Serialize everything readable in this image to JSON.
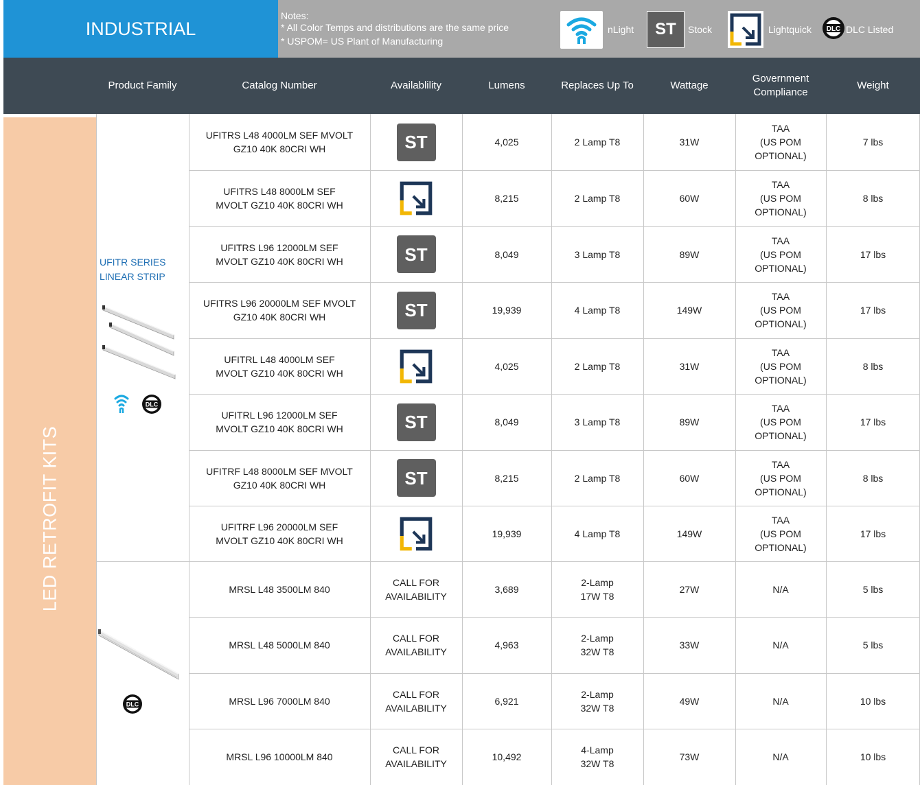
{
  "header": {
    "section": "INDUSTRIAL",
    "notes": {
      "title": "Notes:",
      "line1": "* All Color Temps and distributions are the same price",
      "line2": "* USPOM= US Plant of Manufacturing"
    },
    "legend": {
      "nlight": {
        "label": "nLight",
        "icon": "nlight-wifi-icon"
      },
      "stock": {
        "label": "Stock",
        "badge": "ST",
        "icon": "stock-st-icon"
      },
      "lightquick": {
        "label": "Lightquick",
        "icon": "lightquick-icon"
      },
      "dlc": {
        "label": "DLC Listed",
        "icon": "dlc-listed-icon",
        "badge": "DLC"
      }
    }
  },
  "columns": {
    "family": "Product Family",
    "catalog": "Catalog Number",
    "availability": "Availablility",
    "lumens": "Lumens",
    "replaces": "Replaces Up To",
    "wattage": "Wattage",
    "compliance_line1": "Government",
    "compliance_line2": "Compliance",
    "weight": "Weight"
  },
  "sidebar": {
    "label": "LED RETROFIT KITS"
  },
  "families": {
    "ufitr": {
      "line1": "UFITR SERIES",
      "line2": "LINEAR STRIP"
    }
  },
  "rows": [
    {
      "catalog": [
        "UFITRS L48 4000LM SEF MVOLT",
        "GZ10 40K 80CRI WH"
      ],
      "availability": "stock",
      "lumens": "4,025",
      "replaces": [
        "2 Lamp T8"
      ],
      "wattage": "31W",
      "compliance": [
        "TAA",
        "(US POM",
        "OPTIONAL)"
      ],
      "weight": "7 lbs"
    },
    {
      "catalog": [
        "UFITRS L48 8000LM SEF",
        "MVOLT GZ10 40K 80CRI WH"
      ],
      "availability": "lightquick",
      "lumens": "8,215",
      "replaces": [
        "2 Lamp T8"
      ],
      "wattage": "60W",
      "compliance": [
        "TAA",
        "(US POM",
        "OPTIONAL)"
      ],
      "weight": "8 lbs"
    },
    {
      "catalog": [
        "UFITRS L96 12000LM SEF",
        "MVOLT GZ10 40K 80CRI WH"
      ],
      "availability": "stock",
      "lumens": "8,049",
      "replaces": [
        "3 Lamp T8"
      ],
      "wattage": "89W",
      "compliance": [
        "TAA",
        "(US POM",
        "OPTIONAL)"
      ],
      "weight": "17 lbs"
    },
    {
      "catalog": [
        "UFITRS L96 20000LM SEF MVOLT",
        "GZ10 40K 80CRI WH"
      ],
      "availability": "stock",
      "lumens": "19,939",
      "replaces": [
        "4 Lamp T8"
      ],
      "wattage": "149W",
      "compliance": [
        "TAA",
        "(US POM",
        "OPTIONAL)"
      ],
      "weight": "17 lbs"
    },
    {
      "catalog": [
        "UFITRL L48 4000LM SEF",
        "MVOLT GZ10 40K 80CRI WH"
      ],
      "availability": "lightquick",
      "lumens": "4,025",
      "replaces": [
        "2 Lamp T8"
      ],
      "wattage": "31W",
      "compliance": [
        "TAA",
        "(US POM",
        "OPTIONAL)"
      ],
      "weight": "8 lbs"
    },
    {
      "catalog": [
        "UFITRL L96 12000LM SEF",
        "MVOLT GZ10 40K 80CRI WH"
      ],
      "availability": "stock",
      "lumens": "8,049",
      "replaces": [
        "3 Lamp T8"
      ],
      "wattage": "89W",
      "compliance": [
        "TAA",
        "(US POM",
        "OPTIONAL)"
      ],
      "weight": "17 lbs"
    },
    {
      "catalog": [
        "UFITRF L48 8000LM SEF MVOLT",
        "GZ10 40K 80CRI WH"
      ],
      "availability": "stock",
      "lumens": "8,215",
      "replaces": [
        "2 Lamp T8"
      ],
      "wattage": "60W",
      "compliance": [
        "TAA",
        "(US POM",
        "OPTIONAL)"
      ],
      "weight": "8 lbs"
    },
    {
      "catalog": [
        "UFITRF L96 20000LM SEF",
        "MVOLT GZ10 40K 80CRI WH"
      ],
      "availability": "lightquick",
      "lumens": "19,939",
      "replaces": [
        "4 Lamp T8"
      ],
      "wattage": "149W",
      "compliance": [
        "TAA",
        "(US POM",
        "OPTIONAL)"
      ],
      "weight": "17 lbs"
    },
    {
      "catalog": [
        "MRSL L48 3500LM 840"
      ],
      "availability": [
        "CALL FOR",
        "AVAILABILITY"
      ],
      "lumens": "3,689",
      "replaces": [
        "2-Lamp",
        "17W T8"
      ],
      "wattage": "27W",
      "compliance": [
        "N/A"
      ],
      "weight": "5 lbs"
    },
    {
      "catalog": [
        "MRSL L48 5000LM 840"
      ],
      "availability": [
        "CALL FOR",
        "AVAILABILITY"
      ],
      "lumens": "4,963",
      "replaces": [
        "2-Lamp",
        "32W T8"
      ],
      "wattage": "33W",
      "compliance": [
        "N/A"
      ],
      "weight": "5 lbs"
    },
    {
      "catalog": [
        "MRSL L96 7000LM 840"
      ],
      "availability": [
        "CALL FOR",
        "AVAILABILITY"
      ],
      "lumens": "6,921",
      "replaces": [
        "2-Lamp",
        "32W T8"
      ],
      "wattage": "49W",
      "compliance": [
        "N/A"
      ],
      "weight": "10 lbs"
    },
    {
      "catalog": [
        "MRSL L96 10000LM 840"
      ],
      "availability": [
        "CALL FOR",
        "AVAILABILITY"
      ],
      "lumens": "10,492",
      "replaces": [
        "4-Lamp",
        "32W T8"
      ],
      "wattage": "73W",
      "compliance": [
        "N/A"
      ],
      "weight": "10 lbs"
    }
  ],
  "colors": {
    "header_blue": "#1f93d6",
    "notes_gray": "#a9a9a9",
    "column_header": "#3e4a54",
    "sidebar_peach": "#f7cba7",
    "stock_gray": "#5f5f5f",
    "lightquick_navy": "#1d3657",
    "lightquick_yellow": "#f2b705",
    "nlight_cyan": "#1ba9e1"
  }
}
